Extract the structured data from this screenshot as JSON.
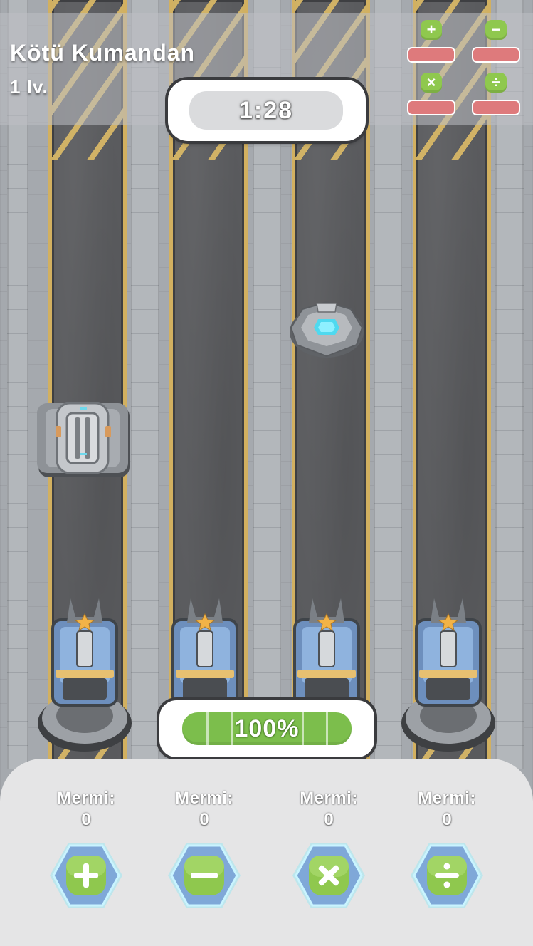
{
  "hud": {
    "enemy_name": "Kötü Kumandan",
    "enemy_level": "1 lv.",
    "timer": "1:28",
    "operator_status": [
      {
        "icon": "plus-icon",
        "glyph": "+"
      },
      {
        "icon": "minus-icon",
        "glyph": "−"
      },
      {
        "icon": "times-icon",
        "glyph": "×"
      },
      {
        "icon": "divide-icon",
        "glyph": "÷"
      }
    ]
  },
  "base_health": {
    "label": "100%",
    "value": 1.0
  },
  "weapons": [
    {
      "label": "Mermi:",
      "ammo": "0",
      "icon": "plus-icon"
    },
    {
      "label": "Mermi:",
      "ammo": "0",
      "icon": "minus-icon"
    },
    {
      "label": "Mermi:",
      "ammo": "0",
      "icon": "times-icon"
    },
    {
      "label": "Mermi:",
      "ammo": "0",
      "icon": "divide-icon"
    }
  ],
  "colors": {
    "operator_green": "#8fc84e",
    "status_bar_red": "#de7a7c",
    "health_green": "#7cbe4c",
    "lane_yellow": "#d2b060",
    "hex_glow": "#8ee6f5"
  }
}
